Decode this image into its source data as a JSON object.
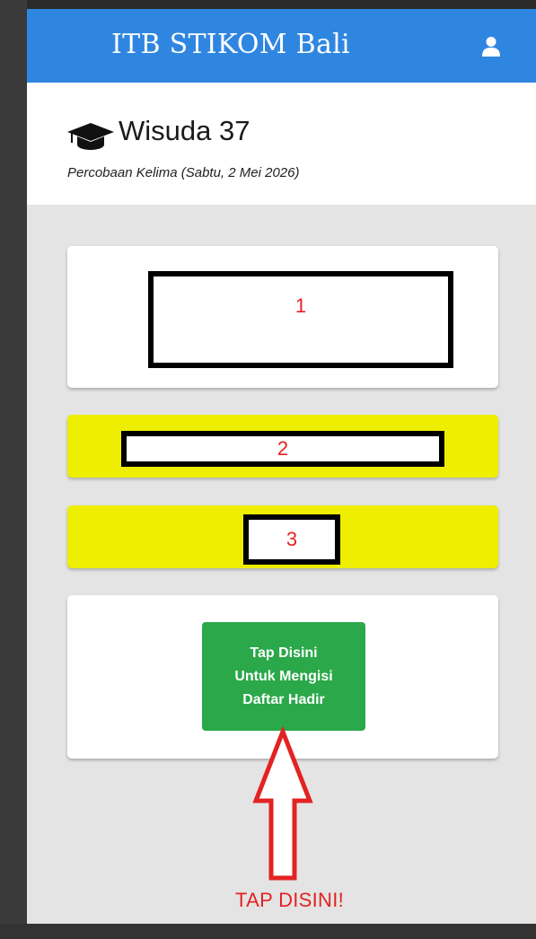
{
  "navbar": {
    "title": "ITB STIKOM Bali",
    "user_icon": "user-icon"
  },
  "header": {
    "icon": "graduation-cap-icon",
    "title": "Wisuda 37",
    "subtitle": "Percobaan Kelima (Sabtu, 2 Mei 2026)"
  },
  "cards": {
    "box1_label": "1",
    "box2_label": "2",
    "box3_label": "3"
  },
  "action": {
    "button_lines": [
      "Tap Disini",
      "Untuk Mengisi",
      "Daftar Hadir"
    ],
    "annotation_text": "TAP DISINI!"
  },
  "colors": {
    "navbar": "#2f86e0",
    "highlight_card": "#eeee00",
    "button": "#2aa84a",
    "annotation": "#e32222"
  }
}
